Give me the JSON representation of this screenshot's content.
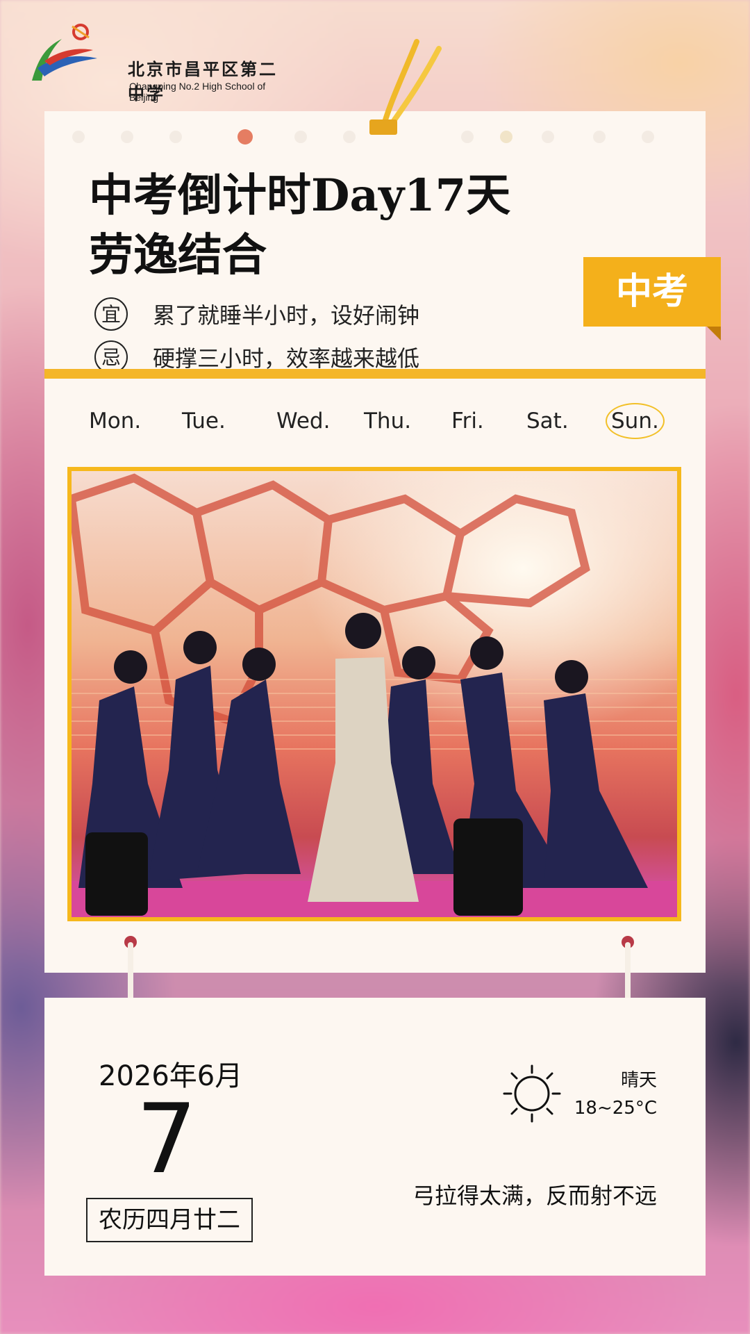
{
  "school": {
    "name_cn": "北京市昌平区第二中学",
    "name_en": "Changping No.2 High School of Beijing"
  },
  "header": {
    "title_line1": "中考倒计时Day17天",
    "title_line2": "劳逸结合",
    "tag": "中考"
  },
  "rules": [
    {
      "badge": "宜",
      "text": "累了就睡半小时，设好闹钟"
    },
    {
      "badge": "忌",
      "text": "硬撑三小时，效率越来越低"
    }
  ],
  "weekdays": [
    "Mon.",
    "Tue.",
    "Wed.",
    "Thu.",
    "Fri.",
    "Sat.",
    "Sun."
  ],
  "active_weekday": "Sun.",
  "calendar": {
    "year_month": "2026年6月",
    "day": "7",
    "lunar": "农历四月廿二"
  },
  "weather": {
    "condition": "晴天",
    "temp": "18~25°C",
    "icon": "sun-icon"
  },
  "motto": "弓拉得太满，反而射不远",
  "colors": {
    "accent_yellow": "#f4b01b",
    "card_bg": "#fdf7f1",
    "dress_navy": "#23244f"
  }
}
